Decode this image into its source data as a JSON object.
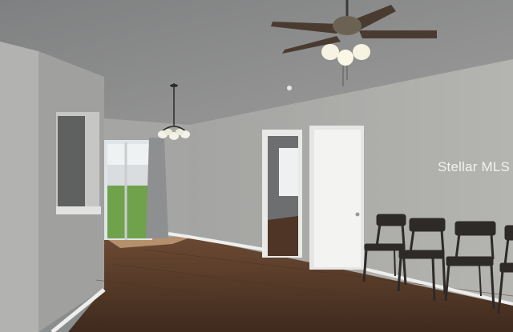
{
  "watermark": {
    "text": "Stellar MLS"
  },
  "colors": {
    "ceiling": "#8f8f8f",
    "wall": "#a9a9a7",
    "floor": "#5a3f2c",
    "trim": "#eeeeec",
    "window_green": "#6fa24a"
  }
}
